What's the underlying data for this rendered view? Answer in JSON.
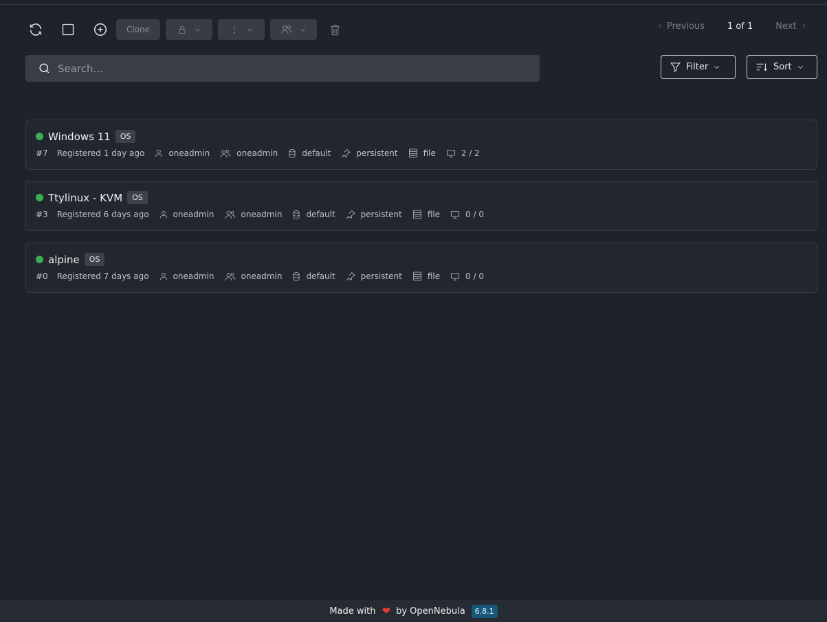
{
  "toolbar": {
    "clone_label": "Clone"
  },
  "pagination": {
    "previous_label": "Previous",
    "page_info": "1 of 1",
    "next_label": "Next"
  },
  "search": {
    "placeholder": "Search..."
  },
  "filter_label": "Filter",
  "sort_label": "Sort",
  "images": [
    {
      "name": "Windows 11",
      "badge": "OS",
      "id": "#7",
      "registered": "Registered 1 day ago",
      "owner": "oneadmin",
      "group": "oneadmin",
      "datastore": "default",
      "persistence": "persistent",
      "type": "file",
      "vms": "2 / 2",
      "status_color": "#3cae54"
    },
    {
      "name": "Ttylinux - KVM",
      "badge": "OS",
      "id": "#3",
      "registered": "Registered 6 days ago",
      "owner": "oneadmin",
      "group": "oneadmin",
      "datastore": "default",
      "persistence": "persistent",
      "type": "file",
      "vms": "0 / 0",
      "status_color": "#3cae54"
    },
    {
      "name": "alpine",
      "badge": "OS",
      "id": "#0",
      "registered": "Registered 7 days ago",
      "owner": "oneadmin",
      "group": "oneadmin",
      "datastore": "default",
      "persistence": "persistent",
      "type": "file",
      "vms": "0 / 0",
      "status_color": "#3cae54"
    }
  ],
  "footer": {
    "made_with": "Made with",
    "by_text": "by OpenNebula",
    "version": "6.8.1"
  }
}
